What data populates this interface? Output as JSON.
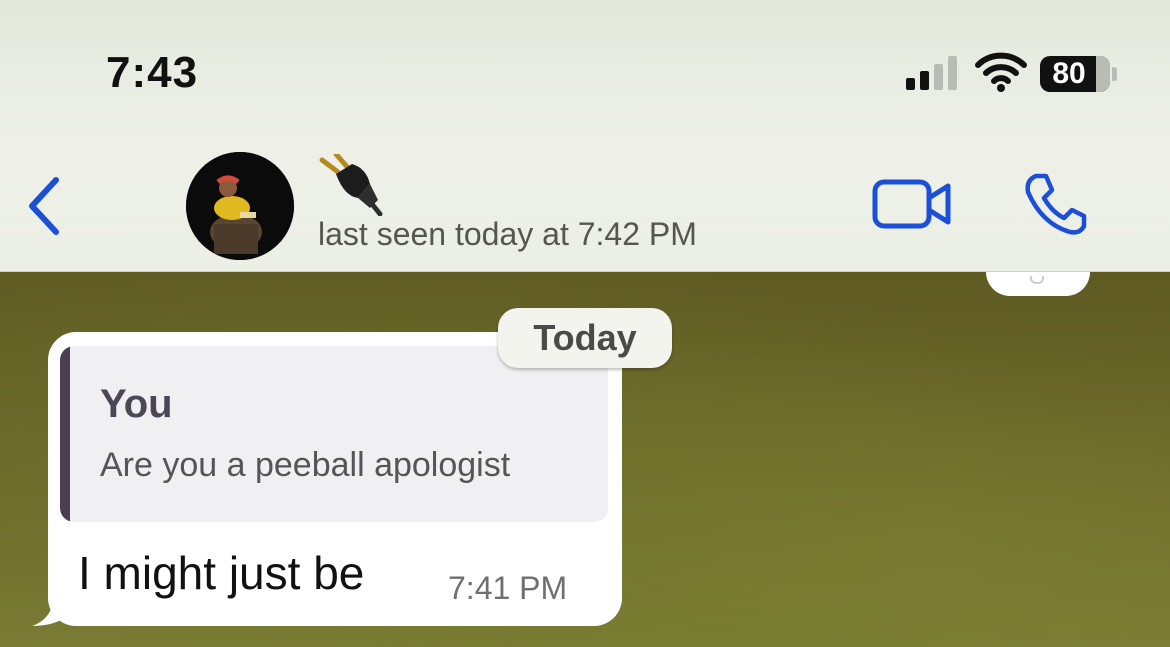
{
  "status_bar": {
    "time": "7:43",
    "battery_level": "80",
    "signal_icon": "cellular-signal-icon",
    "wifi_icon": "wifi-icon"
  },
  "header": {
    "back_icon": "chevron-left-icon",
    "contact_name_emoji": "🔌",
    "last_seen": "last seen today at 7:42 PM",
    "video_call_icon": "video-camera-icon",
    "voice_call_icon": "phone-icon",
    "accent_color": "#1b4fd8"
  },
  "chat": {
    "day_separator": "Today",
    "messages": [
      {
        "direction": "incoming",
        "quoted": {
          "author": "You",
          "text": "Are you a peeball apologist"
        },
        "text": "I might just be",
        "time": "7:41 PM"
      }
    ]
  }
}
